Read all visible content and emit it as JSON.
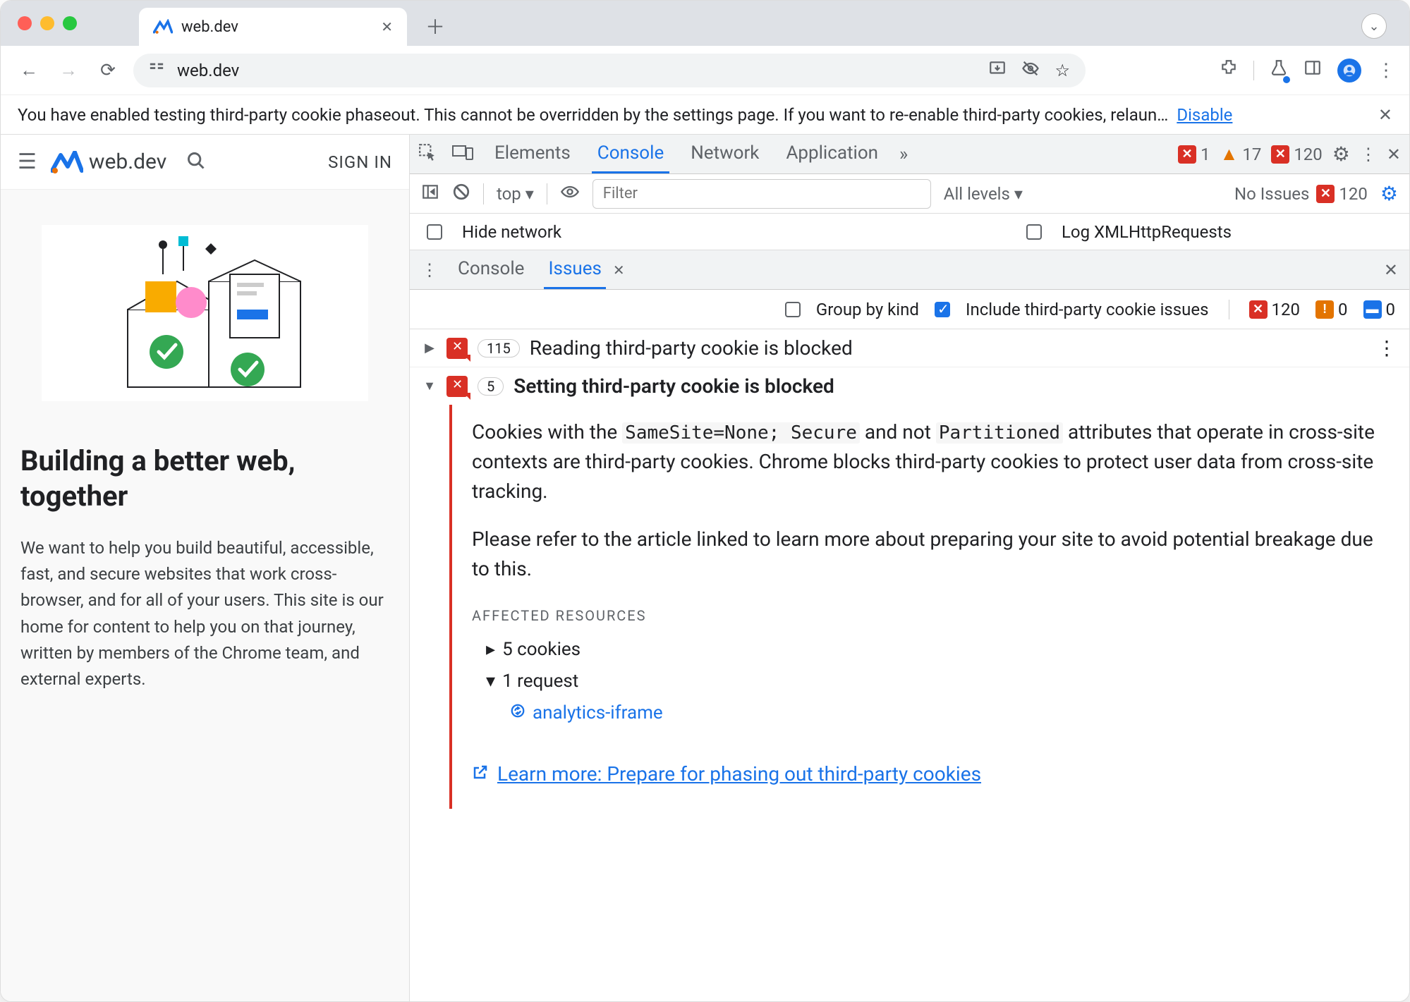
{
  "tab": {
    "title": "web.dev"
  },
  "addressBar": {
    "url": "web.dev"
  },
  "banner": {
    "text": "You have enabled testing third-party cookie phaseout. This cannot be overridden by the settings page. If you want to re-enable third-party cookies, relaun…",
    "disable": "Disable"
  },
  "page": {
    "logoText": "web.dev",
    "signIn": "SIGN IN",
    "title": "Building a better web, together",
    "desc": "We want to help you build beautiful, accessible, fast, and secure websites that work cross-browser, and for all of your users. This site is our home for content to help you on that journey, written by members of the Chrome team, and external experts."
  },
  "devtools": {
    "tabs": {
      "elements": "Elements",
      "console": "Console",
      "network": "Network",
      "application": "Application"
    },
    "errorCount": "1",
    "warnCount": "17",
    "issueCount": "120",
    "context": "top",
    "filterPlaceholder": "Filter",
    "levels": "All levels",
    "noIssues": "No Issues",
    "noIssuesCount": "120",
    "hideNetwork": "Hide network",
    "logXhr": "Log XMLHttpRequests"
  },
  "drawer": {
    "tabs": {
      "console": "Console",
      "issues": "Issues"
    },
    "toolbar": {
      "groupByKind": "Group by kind",
      "include3p": "Include third-party cookie issues",
      "redCount": "120",
      "orangeCount": "0",
      "blueCount": "0"
    }
  },
  "issues": [
    {
      "count": "115",
      "title": "Reading third-party cookie is blocked"
    },
    {
      "count": "5",
      "title": "Setting third-party cookie is blocked"
    }
  ],
  "issueDetail": {
    "p1a": "Cookies with the ",
    "code1": "SameSite=None; Secure",
    "p1b": " and not ",
    "code2": "Partitioned",
    "p1c": " attributes that operate in cross-site contexts are third-party cookies. Chrome blocks third-party cookies to protect user data from cross-site tracking.",
    "p2": "Please refer to the article linked to learn more about preparing your site to avoid potential breakage due to this.",
    "affectedHeading": "Affected Resources",
    "affected": {
      "cookies": "5 cookies",
      "requests": "1 request",
      "requestName": "analytics-iframe"
    },
    "learnMore": "Learn more: Prepare for phasing out third-party cookies"
  }
}
